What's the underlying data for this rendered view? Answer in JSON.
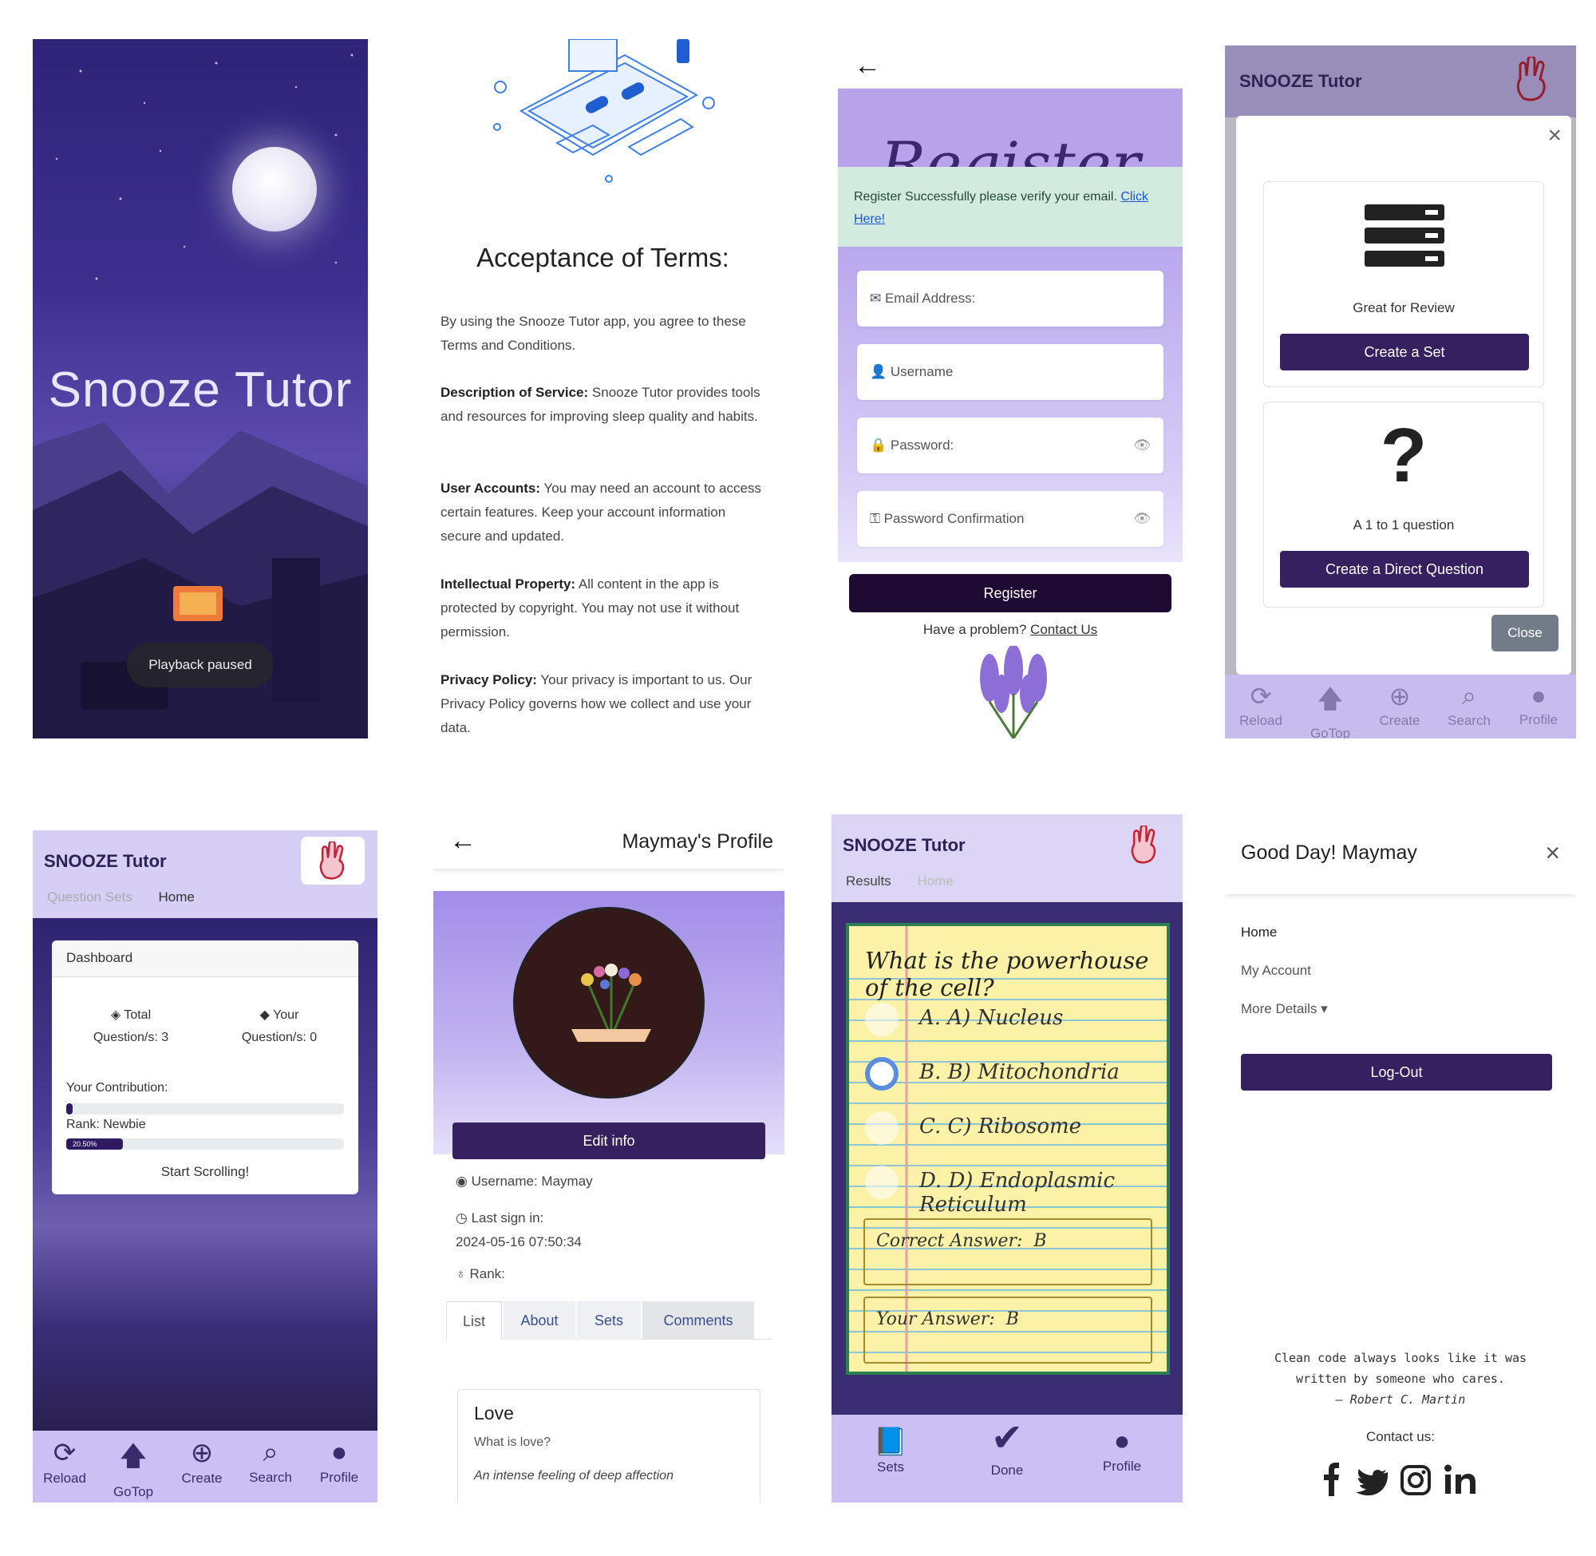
{
  "splash": {
    "title": "Snooze Tutor",
    "toast": "Playback paused"
  },
  "terms": {
    "heading": "Acceptance of Terms:",
    "intro": "By using the Snooze Tutor app, you agree to these Terms and Conditions.",
    "sections": [
      {
        "label": "Description of Service:",
        "text": " Snooze Tutor provides tools and resources for improving sleep quality and habits."
      },
      {
        "label": "User Accounts:",
        "text": " You may need an account to access certain features. Keep your account information secure and updated."
      },
      {
        "label": "Intellectual Property:",
        "text": " All content in the app is protected by copyright. You may not use it without permission."
      },
      {
        "label": "Privacy Policy:",
        "text": " Your privacy is important to us. Our Privacy Policy governs how we collect and use your data."
      }
    ]
  },
  "register": {
    "back": "←",
    "title": "Register",
    "alert_text": "Register Successfully please verify your email.",
    "alert_link": "Click Here!",
    "email_placeholder": "Email Address:",
    "username_placeholder": "Username",
    "password_placeholder": "Password:",
    "password_confirm_placeholder": "Password Confirmation",
    "button": "Register",
    "problem_text": "Have a problem?",
    "contact_link": "Contact Us"
  },
  "create_modal": {
    "brand": "SNOOZE Tutor",
    "set_caption": "Great for Review",
    "set_button": "Create a Set",
    "question_caption": "A 1 to 1 question",
    "question_button": "Create a Direct Question",
    "close_button": "Close",
    "nav": [
      "Reload",
      "GoTop",
      "Create",
      "Search",
      "Profile"
    ]
  },
  "dashboard": {
    "brand": "SNOOZE Tutor",
    "tabs": [
      "Question Sets",
      "Home"
    ],
    "card_title": "Dashboard",
    "total_label": "Total",
    "total_value": "Question/s: 3",
    "your_label": "Your",
    "your_value": "Question/s: 0",
    "contribution_label": "Your Contribution:",
    "contribution_progress": 0,
    "rank_label": "Rank: Newbie",
    "rank_progress_text": "20.50%",
    "rank_progress": 0.205,
    "start": "Start Scrolling!",
    "nav": [
      "Reload",
      "GoTop",
      "Create",
      "Search",
      "Profile"
    ]
  },
  "profile": {
    "back": "←",
    "title": "Maymay's Profile",
    "edit_button": "Edit info",
    "username": "Username: Maymay",
    "last_sign_label": "Last sign in:",
    "last_sign_value": "2024-05-16 07:50:34",
    "rank_label": "Rank:",
    "tabs": [
      "List",
      "About",
      "Sets",
      "Comments"
    ],
    "card_title": "Love",
    "card_question": "What is love?",
    "card_answer": "An intense feeling of deep affection"
  },
  "quiz": {
    "brand": "SNOOZE Tutor",
    "tabs": [
      "Results",
      "Home"
    ],
    "question": "What is the powerhouse of the cell?",
    "options": [
      "A. A) Nucleus",
      "B. B) Mitochondria",
      "C. C) Ribosome",
      "D. D) Endoplasmic Reticulum"
    ],
    "selected_index": 1,
    "correct_label": "Correct Answer:",
    "correct_value": "B",
    "your_label": "Your Answer:",
    "your_value": "B",
    "nav": [
      "Sets",
      "Done",
      "Profile"
    ]
  },
  "menu": {
    "greeting": "Good Day! Maymay",
    "items": [
      "Home",
      "My Account",
      "More Details"
    ],
    "logout": "Log-Out",
    "quote_line1": "Clean code always looks like it was",
    "quote_line2": "written by someone who cares.",
    "quote_author": "– Robert C. Martin",
    "contact": "Contact us:"
  },
  "colors": {
    "brand": "#36205f",
    "lavender": "#b6a3ea",
    "night": "#3a2d74"
  }
}
